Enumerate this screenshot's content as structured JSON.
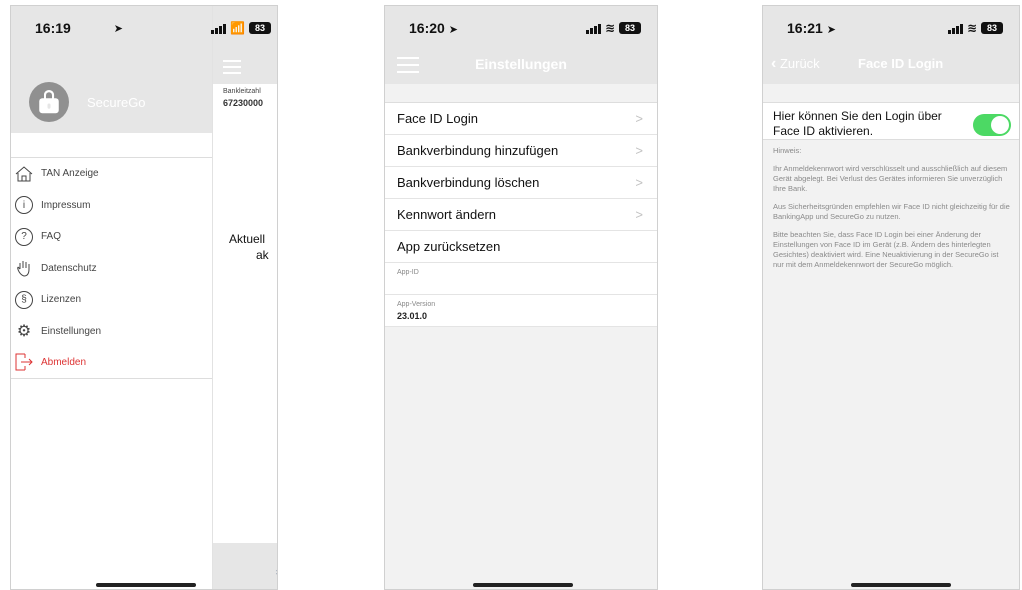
{
  "screen1": {
    "time": "16:19",
    "battery": "83",
    "app_name": "SecureGo",
    "menu": [
      {
        "label": "TAN Anzeige",
        "icon": "house-icon"
      },
      {
        "label": "Impressum",
        "icon": "info-icon"
      },
      {
        "label": "FAQ",
        "icon": "question-icon"
      },
      {
        "label": "Datenschutz",
        "icon": "hand-icon"
      },
      {
        "label": "Lizenzen",
        "icon": "paragraph-icon"
      },
      {
        "label": "Einstellungen",
        "icon": "gear-icon"
      },
      {
        "label": "Abmelden",
        "icon": "logout-icon"
      }
    ],
    "blz_label": "Bankleitzahl",
    "blz_value": "67230000",
    "main_text_1": "Aktuell",
    "main_text_2": "ak"
  },
  "screen2": {
    "time": "16:20",
    "battery": "83",
    "title": "Einstellungen",
    "rows": [
      {
        "label": "Face ID Login",
        "chevron": ">"
      },
      {
        "label": "Bankverbindung hinzufügen",
        "chevron": ">"
      },
      {
        "label": "Bankverbindung löschen",
        "chevron": ">"
      },
      {
        "label": "Kennwort ändern",
        "chevron": ">"
      },
      {
        "label": "App zurücksetzen",
        "chevron": ""
      }
    ],
    "app_id_label": "App-ID",
    "app_version_label": "App-Version",
    "app_version_value": "23.01.0"
  },
  "screen3": {
    "time": "16:21",
    "battery": "83",
    "back_label": "Zurück",
    "title": "Face ID Login",
    "toggle_text": "Hier können Sie den Login über Face ID aktivieren.",
    "toggle_on": true,
    "toggle_color": "#4cd964",
    "hint_label": "Hinweis:",
    "paragraphs": [
      "Ihr Anmeldekennwort wird verschlüsselt und ausschließlich auf diesem Gerät abgelegt. Bei Verlust des Gerätes informieren Sie unverzüglich Ihre Bank.",
      "Aus Sicherheitsgründen empfehlen wir Face ID nicht gleichzeitig für die BankingApp und SecureGo zu nutzen.",
      "Bitte beachten Sie, dass Face ID Login bei einer Änderung der Einstellungen von Face ID im Gerät (z.B. Ändern des hinterlegten Gesichtes) deaktiviert wird. Eine Neuaktivierung in der SecureGo ist nur mit dem Anmeldekennwort der SecureGo möglich."
    ]
  }
}
